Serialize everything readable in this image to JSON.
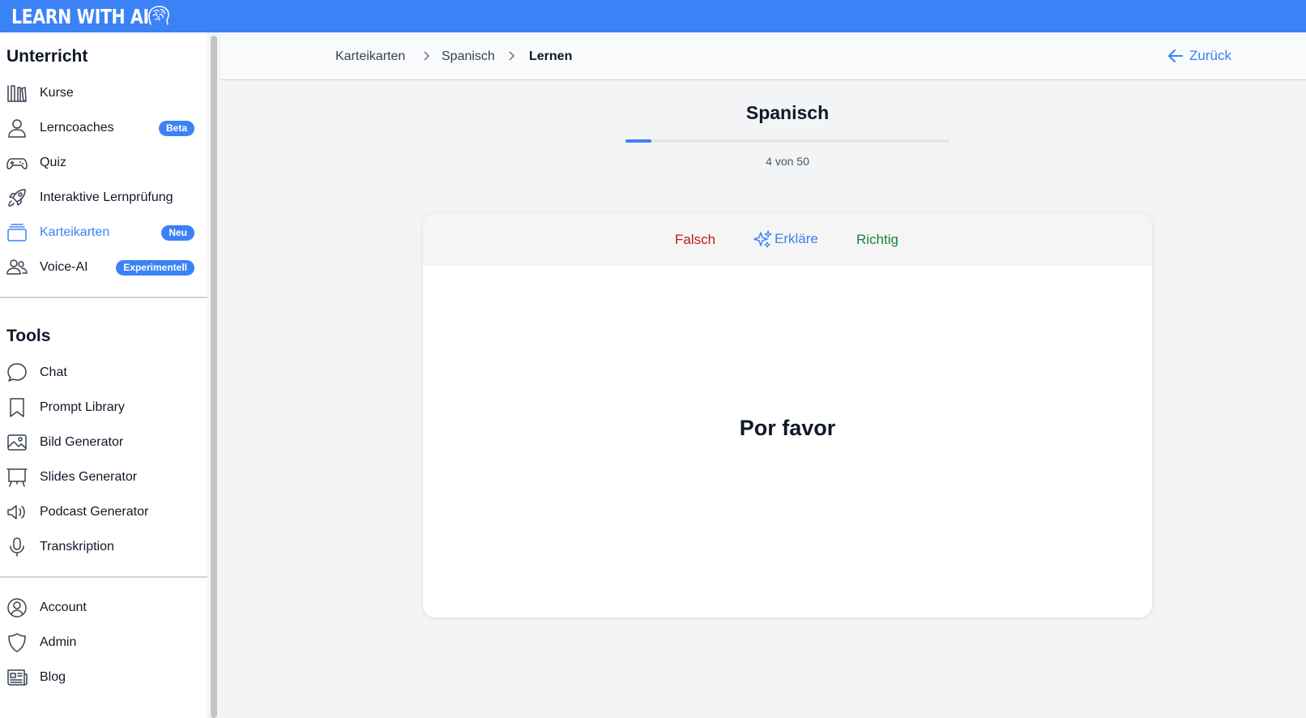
{
  "app": {
    "logo_text": "LEARN WITH AI"
  },
  "sidebar": {
    "section_lessons": "Unterricht",
    "lessons": [
      {
        "label": "Kurse",
        "icon": "library-icon",
        "badge": ""
      },
      {
        "label": "Lerncoaches",
        "icon": "user-icon",
        "badge": "Beta"
      },
      {
        "label": "Quiz",
        "icon": "gamepad-icon",
        "badge": ""
      },
      {
        "label": "Interaktive Lernprüfung",
        "icon": "rocket-icon",
        "badge": ""
      },
      {
        "label": "Karteikarten",
        "icon": "card-stack-icon",
        "badge": "Neu",
        "active": true
      },
      {
        "label": "Voice-AI",
        "icon": "users-icon",
        "badge": "Experimentell"
      }
    ],
    "section_tools": "Tools",
    "tools": [
      {
        "label": "Chat",
        "icon": "chat-icon"
      },
      {
        "label": "Prompt Library",
        "icon": "bookmark-icon"
      },
      {
        "label": "Bild Generator",
        "icon": "image-icon"
      },
      {
        "label": "Slides Generator",
        "icon": "presentation-icon"
      },
      {
        "label": "Podcast Generator",
        "icon": "speaker-icon"
      },
      {
        "label": "Transkription",
        "icon": "microphone-icon"
      }
    ],
    "account": [
      {
        "label": "Account",
        "icon": "user-circle-icon"
      },
      {
        "label": "Admin",
        "icon": "shield-icon"
      },
      {
        "label": "Blog",
        "icon": "newspaper-icon"
      }
    ]
  },
  "breadcrumb": [
    "Karteikarten",
    "Spanisch",
    "Lernen"
  ],
  "back_label": "Zurück",
  "deck": {
    "title": "Spanisch",
    "progress_text": "4 von 50",
    "progress_fraction": 0.08
  },
  "card": {
    "wrong_label": "Falsch",
    "explain_label": "Erkläre",
    "right_label": "Richtig",
    "word": "Por favor"
  },
  "colors": {
    "accent": "#3b82f6",
    "wrong": "#b91c1c",
    "right": "#15803d"
  }
}
